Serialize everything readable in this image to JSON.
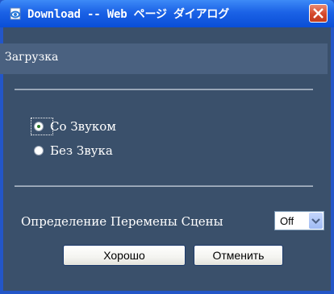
{
  "window": {
    "title": "Download -- Web ページ ダイアログ",
    "title_icon": "ie-page-icon",
    "close_icon": "close-icon"
  },
  "header": {
    "title": "Загрузка"
  },
  "sound_options": [
    {
      "label": "Со Звуком",
      "checked": true
    },
    {
      "label": "Без Звука",
      "checked": false
    }
  ],
  "scene_detection": {
    "label": "Определение Перемены Сцены",
    "selected": "Off"
  },
  "buttons": {
    "ok": "Хорошо",
    "cancel": "Отменить"
  },
  "colors": {
    "dialog_bg": "#3a506b",
    "header_band": "#4a6180",
    "titlebar": "#1b62e6",
    "close_button": "#d4482b"
  }
}
